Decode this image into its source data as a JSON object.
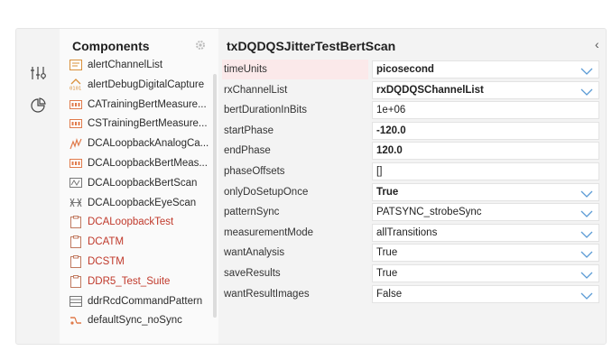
{
  "components": {
    "title": "Components",
    "items": [
      {
        "label": "alertChannelList",
        "icon": "list-icon",
        "red": false
      },
      {
        "label": "alertDebugDigitalCapture",
        "icon": "digital-capture-icon",
        "red": false
      },
      {
        "label": "CATrainingBertMeasure...",
        "icon": "bert-measure-icon",
        "red": false
      },
      {
        "label": "CSTrainingBertMeasure...",
        "icon": "bert-measure-icon",
        "red": false
      },
      {
        "label": "DCALoopbackAnalogCa...",
        "icon": "analog-capture-icon",
        "red": false
      },
      {
        "label": "DCALoopbackBertMeas...",
        "icon": "bert-measure-icon",
        "red": false
      },
      {
        "label": "DCALoopbackBertScan",
        "icon": "bert-scan-icon",
        "red": false
      },
      {
        "label": "DCALoopbackEyeScan",
        "icon": "eye-scan-icon",
        "red": false
      },
      {
        "label": "DCALoopbackTest",
        "icon": "clipboard-icon",
        "red": true
      },
      {
        "label": "DCATM",
        "icon": "clipboard-icon",
        "red": true
      },
      {
        "label": "DCSTM",
        "icon": "clipboard-icon",
        "red": true
      },
      {
        "label": "DDR5_Test_Suite",
        "icon": "clipboard-icon",
        "red": true
      },
      {
        "label": "ddrRcdCommandPattern",
        "icon": "pattern-icon",
        "red": false
      },
      {
        "label": "defaultSync_noSync",
        "icon": "sync-icon",
        "red": false
      }
    ]
  },
  "properties": {
    "title": "txDQDQSJitterTestBertScan",
    "rows": [
      {
        "name": "timeUnits",
        "value": "picosecond",
        "bold": true,
        "select": true,
        "highlight": true
      },
      {
        "name": "rxChannelList",
        "value": "rxDQDQSChannelList",
        "bold": true,
        "select": true,
        "highlight": false
      },
      {
        "name": "bertDurationInBits",
        "value": "1e+06",
        "bold": false,
        "select": false,
        "highlight": false
      },
      {
        "name": "startPhase",
        "value": "-120.0",
        "bold": true,
        "select": false,
        "highlight": false
      },
      {
        "name": "endPhase",
        "value": "120.0",
        "bold": true,
        "select": false,
        "highlight": false
      },
      {
        "name": "phaseOffsets",
        "value": "[]",
        "bold": false,
        "select": false,
        "highlight": false
      },
      {
        "name": "onlyDoSetupOnce",
        "value": "True",
        "bold": true,
        "select": true,
        "highlight": false
      },
      {
        "name": "patternSync",
        "value": "PATSYNC_strobeSync",
        "bold": false,
        "select": true,
        "highlight": false
      },
      {
        "name": "measurementMode",
        "value": "allTransitions",
        "bold": false,
        "select": true,
        "highlight": false
      },
      {
        "name": "wantAnalysis",
        "value": "True",
        "bold": false,
        "select": true,
        "highlight": false
      },
      {
        "name": "saveResults",
        "value": "True",
        "bold": false,
        "select": true,
        "highlight": false
      },
      {
        "name": "wantResultImages",
        "value": "False",
        "bold": false,
        "select": true,
        "highlight": false
      }
    ]
  },
  "colors": {
    "accent": "#4a90d9",
    "error_text": "#c0392b",
    "highlight_row": "#fbe9ea"
  }
}
